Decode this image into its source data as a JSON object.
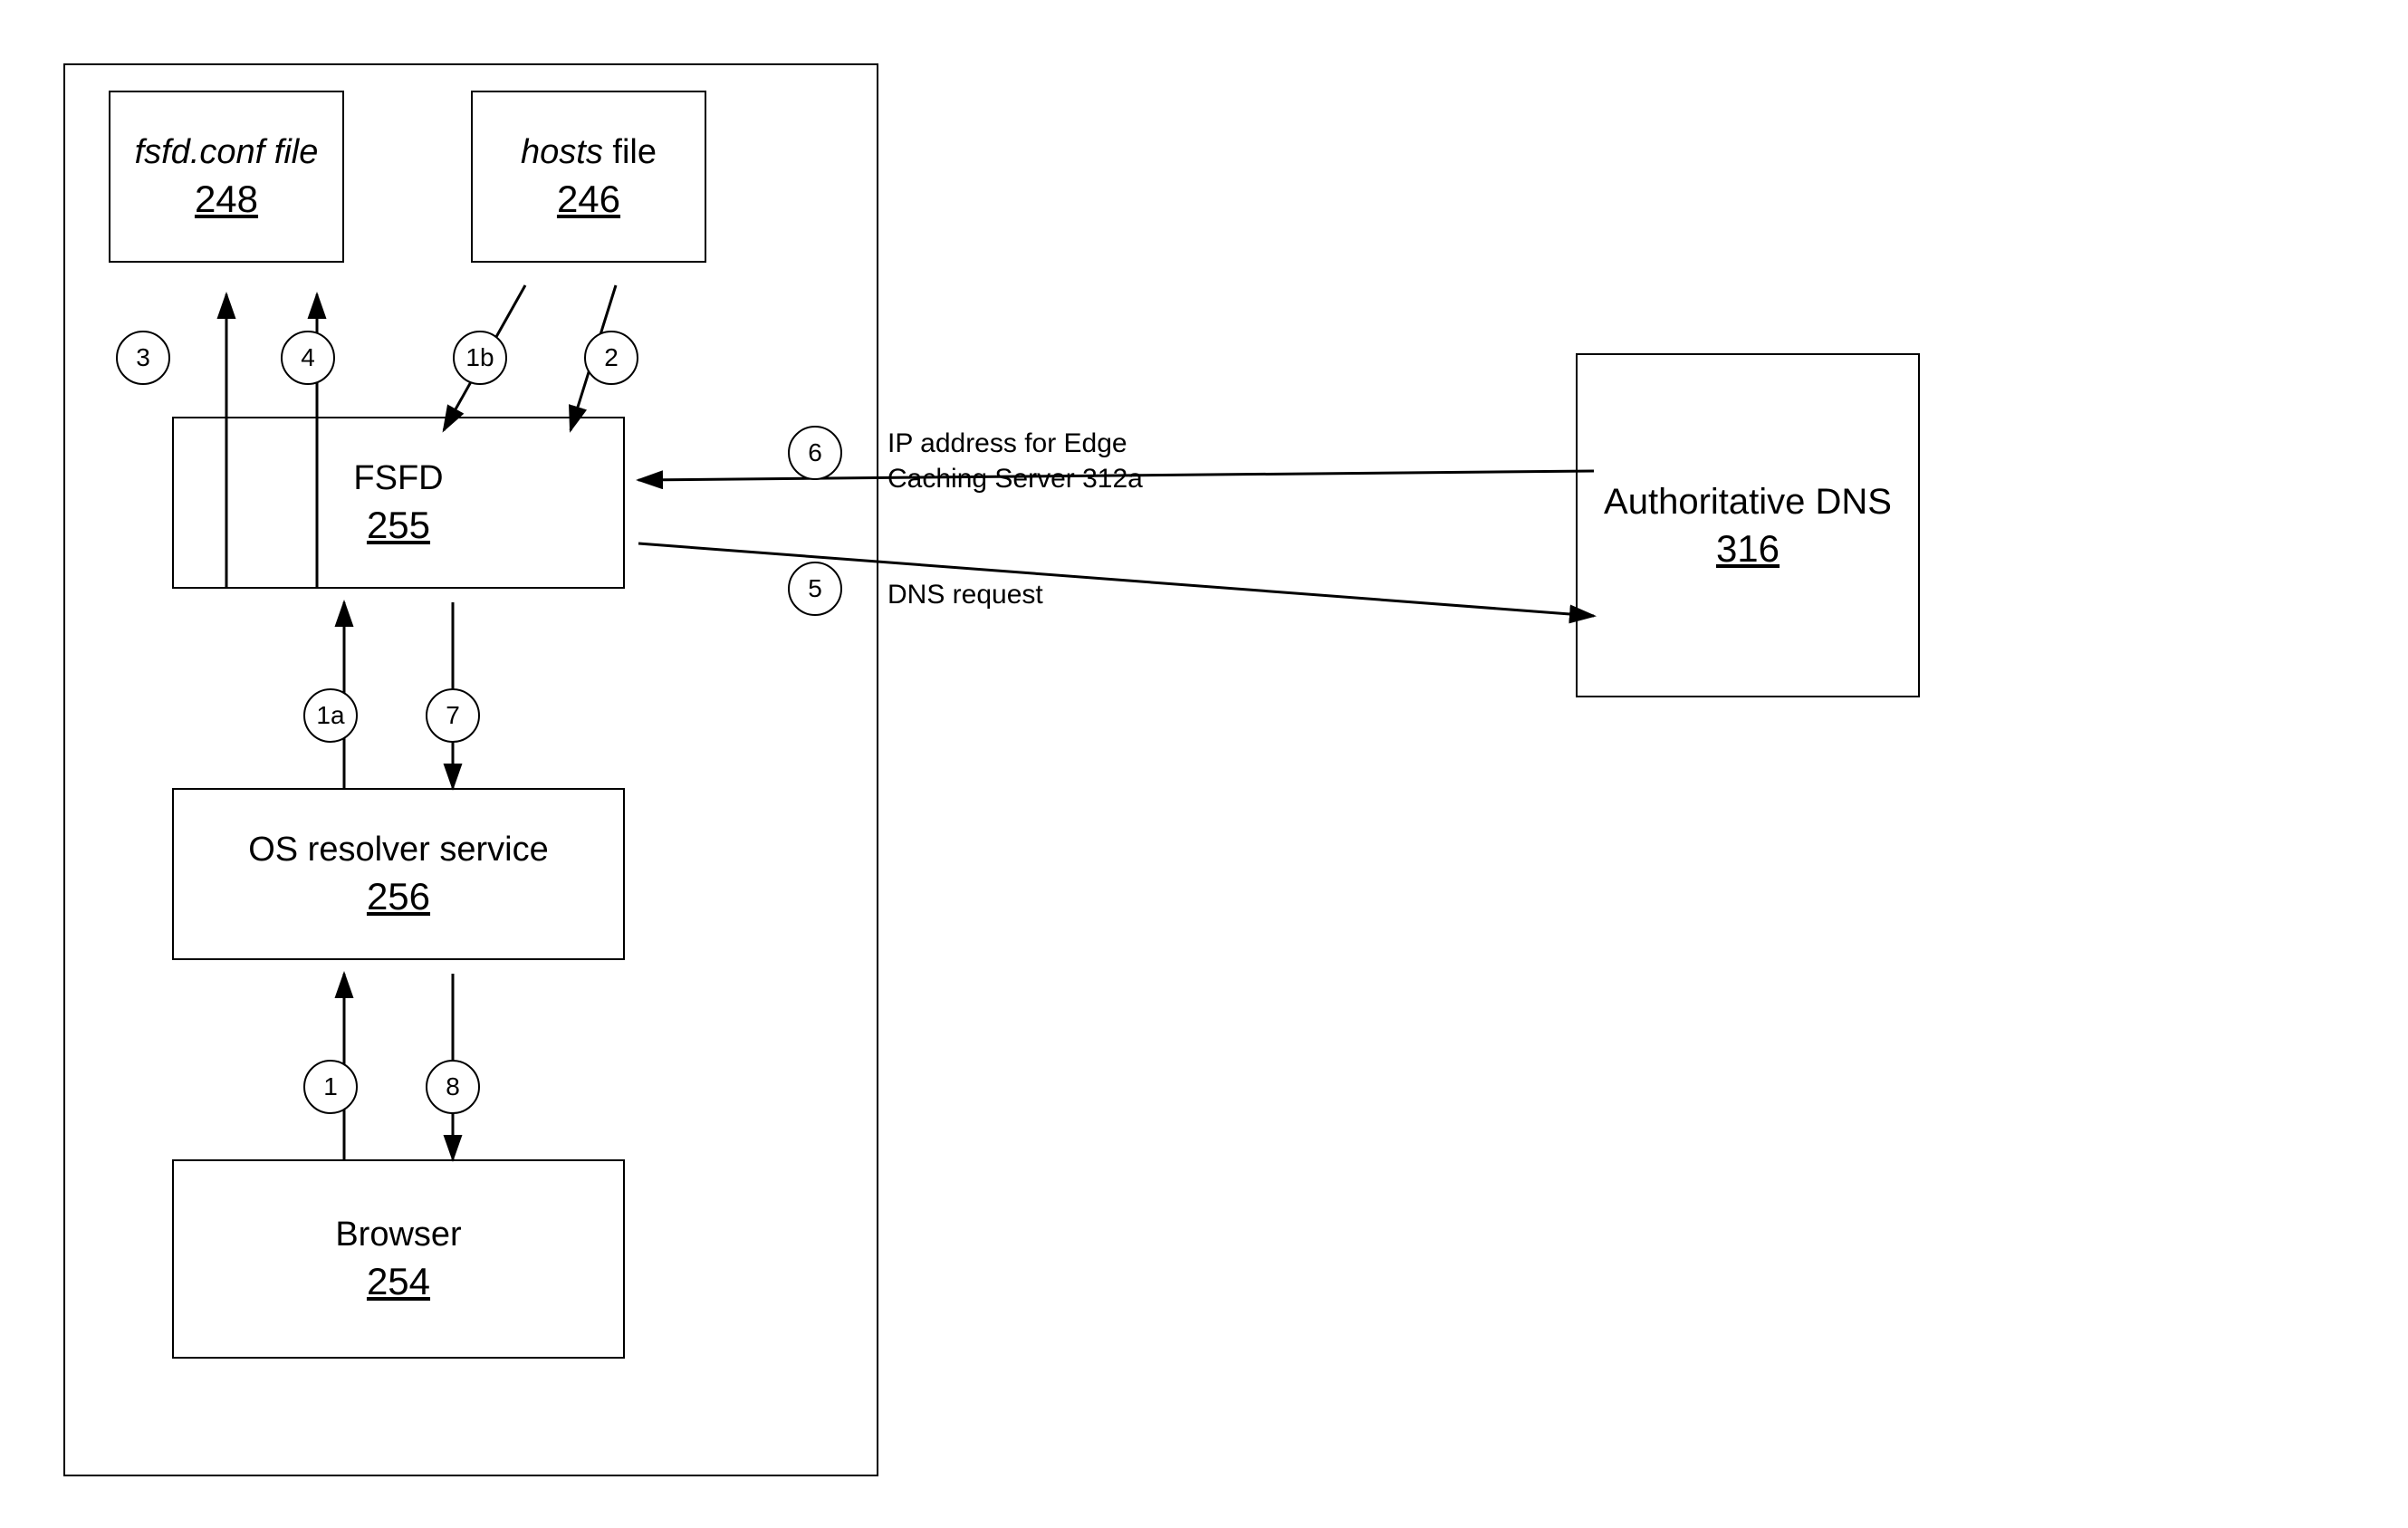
{
  "diagram": {
    "mainBox": {
      "label": "main-enclosure"
    },
    "authDNS": {
      "title": "Authoritative DNS",
      "number": "316"
    },
    "fsfdConf": {
      "title": "fsfd.conf file",
      "number": "248"
    },
    "hostsFile": {
      "title": "hosts file",
      "number": "246"
    },
    "fsfd": {
      "title": "FSFD",
      "number": "255"
    },
    "osResolver": {
      "title": "OS resolver service",
      "number": "256"
    },
    "browser": {
      "title": "Browser",
      "number": "254"
    },
    "circles": {
      "c1": "1",
      "c1a": "1a",
      "c1b": "1b",
      "c2": "2",
      "c3": "3",
      "c4": "4",
      "c5": "5",
      "c6": "6",
      "c7": "7",
      "c8": "8"
    },
    "arrowLabels": {
      "dnsRequest": "DNS request",
      "ipAddress": "IP address for Edge\nCaching Server 312a"
    }
  }
}
